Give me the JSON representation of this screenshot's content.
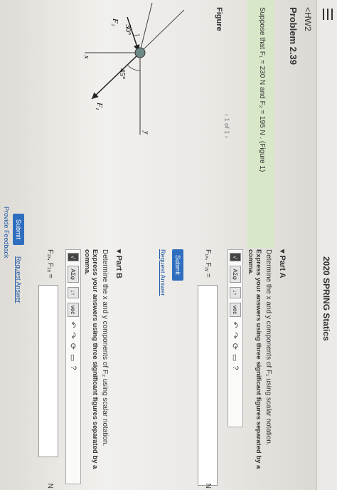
{
  "app": {
    "course_title": "2020 SPRING Statics"
  },
  "nav": {
    "back_label": "<HW2",
    "problem_title": "Problem 2.39"
  },
  "intro": {
    "text": "Suppose that F₁ = 230 N and F₂ = 195 N . (Figure 1)"
  },
  "figure": {
    "label": "Figure",
    "pager": "1 of 1",
    "prev_icon": "chevron-left-icon",
    "next_icon": "chevron-right-icon",
    "labels": {
      "angle45": "45°",
      "angle30": "30°",
      "f1": "F₁",
      "f2": "F₂",
      "y": "y",
      "x": "x"
    }
  },
  "toolbar": {
    "matrix_label": "√",
    "greek_label": "ΑΣφ",
    "arrows_label": "↓↑",
    "vec_label": "vec",
    "icons": [
      "undo-icon",
      "redo-icon",
      "refresh-icon",
      "keyboard-icon",
      "help-icon"
    ],
    "help_label": "?"
  },
  "partA": {
    "title": "Part A",
    "instruction": "Determine the x and y components of F₁ using scalar notation.",
    "instruction_bold": "Express your answers using three significant figures separated by a comma.",
    "answer_label": "F₁ₓ, F₁ᵧ =",
    "answer_value": "",
    "unit": "N",
    "submit_label": "Submit",
    "request_label": "Request Answer"
  },
  "partB": {
    "title": "Part B",
    "instruction": "Determine the x and y components of F₂ using scalar notation.",
    "instruction_bold": "Express your answers using three significant figures separated by a comma.",
    "answer_label": "F₂ₓ, F₂ᵧ =",
    "answer_value": "",
    "unit": "N",
    "submit_label": "Submit",
    "request_label": "Request Answer"
  },
  "footer": {
    "feedback_label": "Provide Feedback"
  }
}
